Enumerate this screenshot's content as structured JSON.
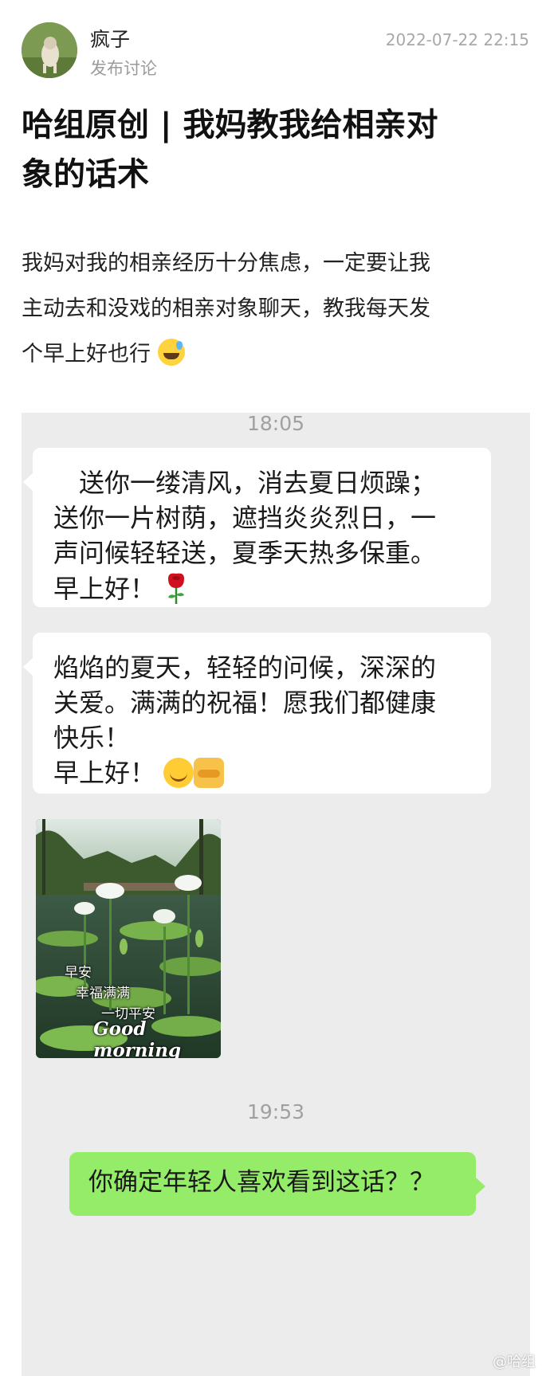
{
  "post": {
    "author": "疯子",
    "subtitle": "发布讨论",
    "timestamp": "2022-07-22 22:15",
    "title_lines": [
      "哈组原创 | 我妈教我给相亲对",
      "象的话术"
    ],
    "body_lines": [
      "我妈对我的相亲经历十分焦虑，一定要让我",
      "主动去和没戏的相亲对象聊天，教我每天发",
      "个早上好也行"
    ],
    "body_emoji": "sweat-smile-emoji"
  },
  "chat": {
    "time1": "18:05",
    "msg1_lines": [
      "　送你一缕清风，消去夏日烦躁；",
      "送你一片树荫，遮挡炎炎烈日，一",
      "声问候轻轻送，夏季天热多保重。",
      "早上好！"
    ],
    "msg1_emoji": "rose-icon",
    "msg2_lines": [
      "焰焰的夏天，轻轻的问候，深深的",
      "关爱。满满的祝福！愿我们都健康",
      "快乐！",
      "早上好！"
    ],
    "msg2_emoji": [
      "smile-icon",
      "handshake-icon"
    ],
    "image": {
      "text1": "早安",
      "text2": "幸福满满",
      "text3": "一切平安",
      "text4": "Good morning"
    },
    "time2": "19:53",
    "reply": "你确定年轻人喜欢看到这话？？"
  },
  "watermark": "@哈组",
  "colors": {
    "chat_bg": "#ececec",
    "bubble_in": "#ffffff",
    "bubble_out": "#95ec69",
    "muted": "#9a9a9a"
  }
}
